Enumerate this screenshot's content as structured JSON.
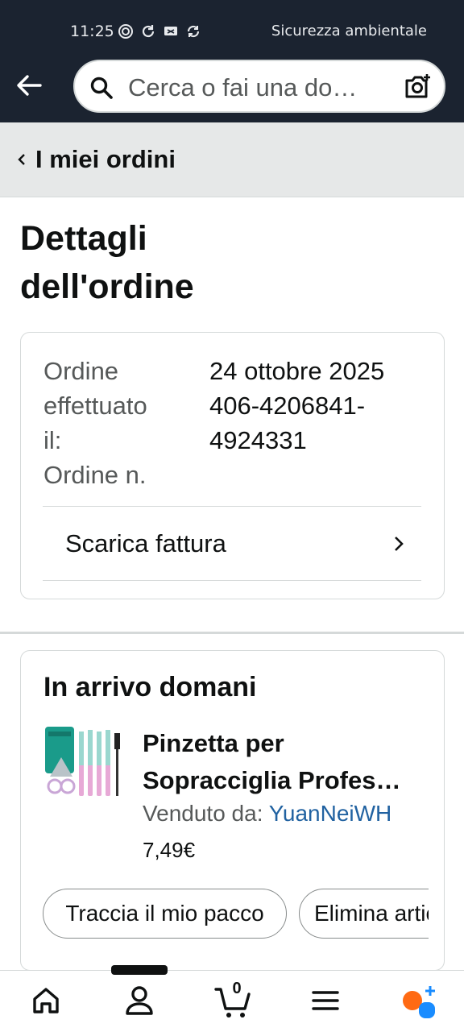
{
  "status_bar": {
    "time": "11:25",
    "right_text": "Sicurezza ambientale",
    "icons": [
      "nfc-icon",
      "sync-icon",
      "cast-icon",
      "refresh-icon"
    ]
  },
  "search": {
    "placeholder": "Cerca o fai una do…"
  },
  "breadcrumb": {
    "label": "I miei ordini"
  },
  "page": {
    "title_line1": "Dettagli",
    "title_line2": "dell'ordine"
  },
  "order_info": {
    "label_lines": [
      "Ordine",
      "effettuato",
      "il:",
      "Ordine n."
    ],
    "value_lines": [
      "24 ottobre 2025",
      "406-4206841-",
      "4924331"
    ],
    "invoice_label": "Scarica fattura"
  },
  "shipment": {
    "title": "In arrivo domani",
    "product_name_line1": "Pinzetta per",
    "product_name_line2": "Sopracciglia Profes…",
    "seller_prefix": "Venduto da:",
    "seller_name": "YuanNeiWH",
    "price": "7,49€",
    "track_button": "Traccia il mio pacco",
    "delete_button": "Elimina articolo"
  },
  "bottom_nav": {
    "cart_count": "0",
    "items": [
      "home-icon",
      "account-icon",
      "cart-icon",
      "menu-icon",
      "rufus-icon"
    ]
  },
  "colors": {
    "header_bg": "#1b2330",
    "link": "#2162a1",
    "accent_orange": "#ff6a13",
    "accent_blue": "#1a8cff"
  }
}
